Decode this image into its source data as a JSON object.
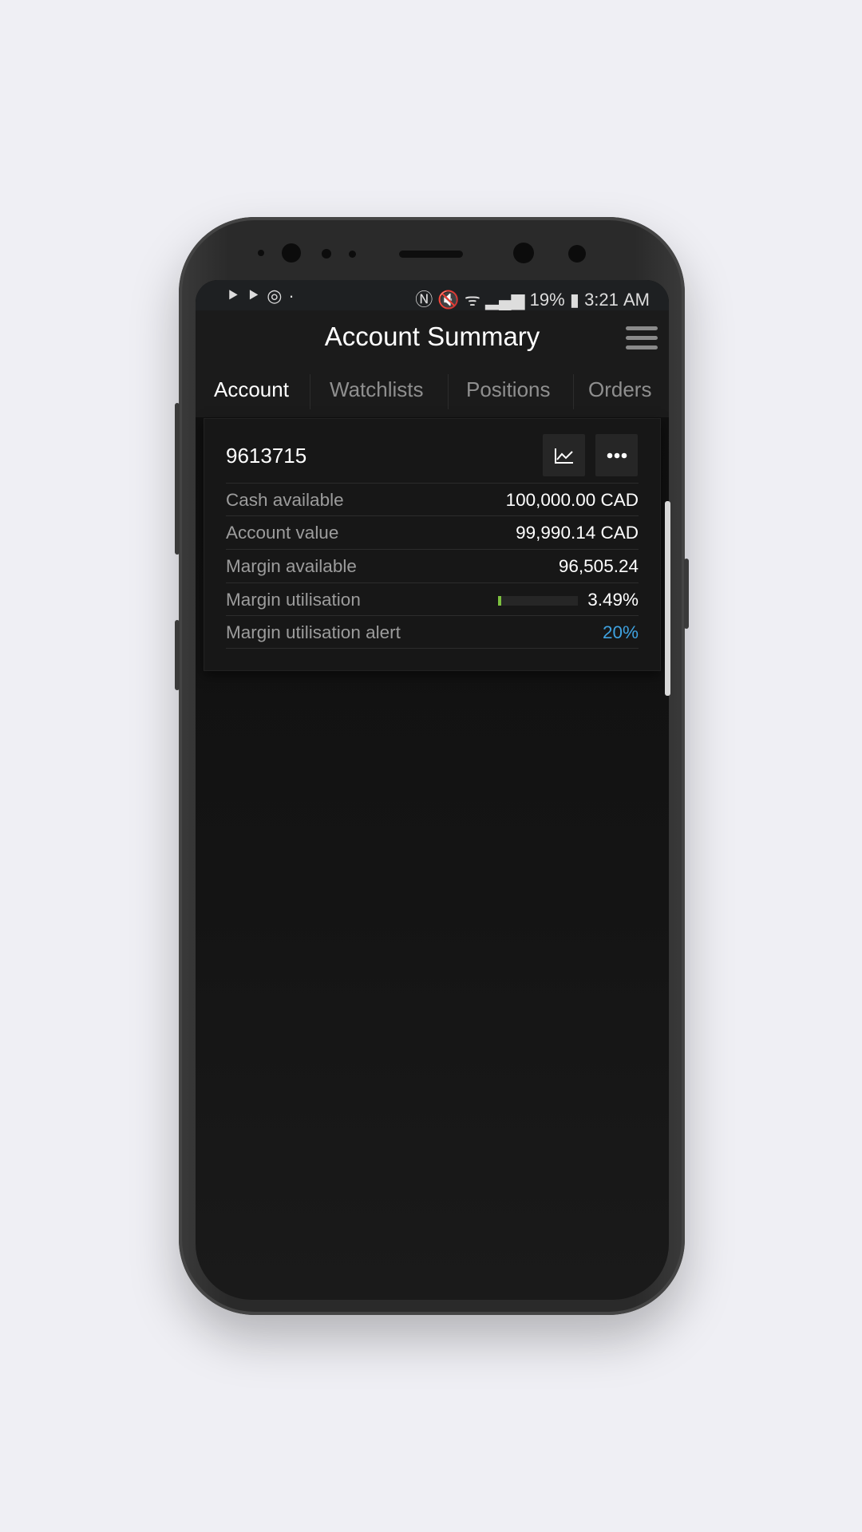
{
  "status_bar": {
    "left_icons": [
      "play-store-download-icon",
      "play-store-icon",
      "sync-icon",
      "dot-icon"
    ],
    "right_icons": [
      "nfc-icon",
      "mute-icon",
      "wifi-icon",
      "signal-icon"
    ],
    "battery": "19%",
    "time": "3:21 AM"
  },
  "header": {
    "title": "Account Summary",
    "menu_icon": "hamburger-icon"
  },
  "tabs": [
    {
      "label": "Account",
      "active": true
    },
    {
      "label": "Watchlists"
    },
    {
      "label": "Positions"
    },
    {
      "label": "Orders"
    }
  ],
  "account": {
    "number": "9613715",
    "chart_icon": "line-chart-icon",
    "more_icon": "more-dots-icon",
    "rows": [
      {
        "label": "Cash available",
        "value": "100,000.00 CAD"
      },
      {
        "label": "Account value",
        "value": "99,990.14 CAD"
      },
      {
        "label": "Margin available",
        "value": "96,505.24"
      },
      {
        "label": "Margin utilisation",
        "value": "3.49%",
        "progress_percent": 3.49
      },
      {
        "label": "Margin utilisation alert",
        "value": "20%"
      }
    ]
  },
  "colors": {
    "progress": "#7cc13f",
    "alert_link": "#3fa2e0",
    "background": "#0f0f0f"
  }
}
